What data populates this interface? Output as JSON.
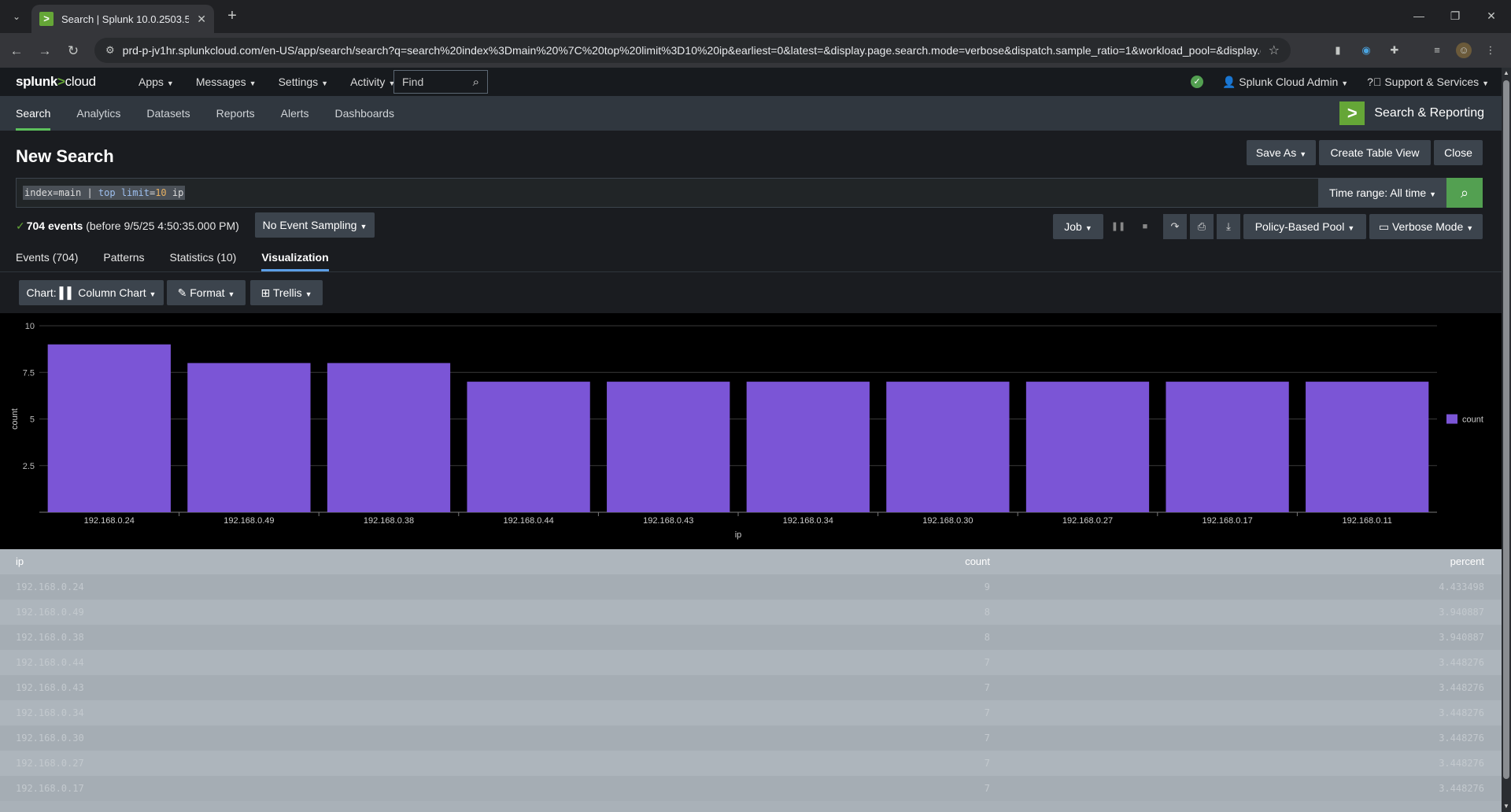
{
  "browser": {
    "tab_title": "Search | Splunk 10.0.2503.5",
    "url": "prd-p-jv1hr.splunkcloud.com/en-US/app/search/search?q=search%20index%3Dmain%20%7C%20top%20limit%3D10%20ip&earliest=0&latest=&display.page.search.mode=verbose&dispatch.sample_ratio=1&workload_pool=&display.g..."
  },
  "topnav": {
    "logo_a": "splunk",
    "logo_b": ">",
    "logo_c": "cloud",
    "apps": "Apps",
    "messages": "Messages",
    "settings": "Settings",
    "activity": "Activity",
    "find": "Find",
    "user": "Splunk Cloud Admin",
    "support": "Support & Services"
  },
  "appbar": {
    "items": [
      "Search",
      "Analytics",
      "Datasets",
      "Reports",
      "Alerts",
      "Dashboards"
    ],
    "app_name": "Search & Reporting"
  },
  "page": {
    "title": "New Search",
    "save_as": "Save As",
    "create_table_view": "Create Table View",
    "close": "Close",
    "query_a": "index=main | ",
    "query_kw": "top",
    "query_b": " limit",
    "query_eq": "=",
    "query_num": "10",
    "query_c": " ip",
    "time_range": "Time range: All time",
    "events_count": "704 events",
    "events_suffix": "(before 9/5/25 4:50:35.000 PM)",
    "sampling": "No Event Sampling",
    "job": "Job",
    "pool": "Policy-Based Pool",
    "mode": "Verbose Mode"
  },
  "tabs": [
    "Events (704)",
    "Patterns",
    "Statistics (10)",
    "Visualization"
  ],
  "viz_controls": {
    "chart": "Chart: ▌▌ Column Chart",
    "format": "Format",
    "trellis": "Trellis"
  },
  "chart_data": {
    "type": "bar",
    "categories": [
      "192.168.0.24",
      "192.168.0.49",
      "192.168.0.38",
      "192.168.0.44",
      "192.168.0.43",
      "192.168.0.34",
      "192.168.0.30",
      "192.168.0.27",
      "192.168.0.17",
      "192.168.0.11"
    ],
    "series": [
      {
        "name": "count",
        "values": [
          9,
          8,
          8,
          7,
          7,
          7,
          7,
          7,
          7,
          7
        ]
      }
    ],
    "xlabel": "ip",
    "ylabel": "count",
    "ylim": [
      0,
      10
    ],
    "yticks": [
      "2.5",
      "5",
      "7.5",
      "10"
    ],
    "bar_color": "#7b55d6",
    "grid": true,
    "legend": "right"
  },
  "table": {
    "headers": [
      "ip",
      "count",
      "percent"
    ],
    "rows": [
      [
        "192.168.0.24",
        "9",
        "4.433498"
      ],
      [
        "192.168.0.49",
        "8",
        "3.940887"
      ],
      [
        "192.168.0.38",
        "8",
        "3.940887"
      ],
      [
        "192.168.0.44",
        "7",
        "3.448276"
      ],
      [
        "192.168.0.43",
        "7",
        "3.448276"
      ],
      [
        "192.168.0.34",
        "7",
        "3.448276"
      ],
      [
        "192.168.0.30",
        "7",
        "3.448276"
      ],
      [
        "192.168.0.27",
        "7",
        "3.448276"
      ],
      [
        "192.168.0.17",
        "7",
        "3.448276"
      ]
    ]
  }
}
